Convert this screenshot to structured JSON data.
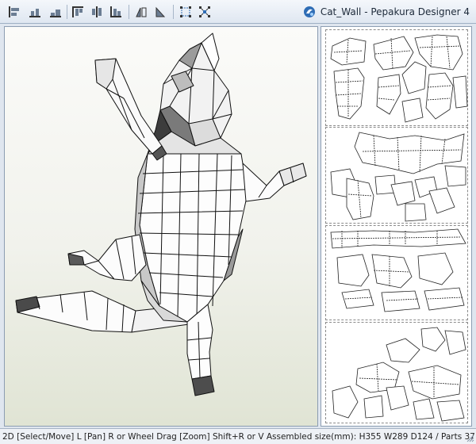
{
  "window": {
    "title": "Cat_Wall - Pepakura Designer 4",
    "logo_icon": "pepakura-logo-icon"
  },
  "toolbar": {
    "buttons": [
      {
        "name": "align-left-icon"
      },
      {
        "name": "align-center-horizontal-icon"
      },
      {
        "name": "align-right-icon"
      },
      {
        "name": "align-top-icon"
      },
      {
        "name": "align-middle-vertical-icon"
      },
      {
        "name": "align-bottom-icon"
      },
      {
        "name": "flip-horizontal-icon"
      },
      {
        "name": "rotate-icon"
      },
      {
        "name": "select-box-icon"
      },
      {
        "name": "select-parts-icon"
      }
    ]
  },
  "viewport3d": {
    "subject": "cat-model-3d",
    "background_top": "#fbfbf9",
    "background_bottom": "#e0e4d4"
  },
  "viewport2d": {
    "sheets": 4
  },
  "status": {
    "text": "2D [Select/Move] L [Pan] R or Wheel Drag [Zoom] Shift+R or V  Assembled size(mm): H355 W289 D124 / Parts 37"
  },
  "colors": {
    "accent": "#2f6db5",
    "panel_border": "#8c9db2",
    "status_bg": "#eef1f6"
  }
}
